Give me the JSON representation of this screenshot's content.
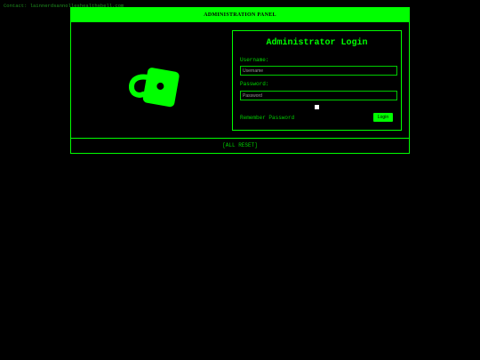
{
  "contact": {
    "text": "Contact: lainnerdsannolleshealthsbell.com"
  },
  "panel": {
    "title": "ADMINISTRATION PANEL",
    "footer": "[ALL RESET]"
  },
  "lock": {
    "icon": "padlock-icon",
    "color": "#00ff00"
  },
  "login": {
    "title": "Administrator Login",
    "username_label": "Username:",
    "username_placeholder": "Username",
    "username_value": "",
    "password_label": "Password:",
    "password_placeholder": "Password",
    "password_value": "",
    "remember_label": "Remember Password",
    "remember_checked": false,
    "button_label": "Login"
  },
  "colors": {
    "background": "#000000",
    "accent": "#00ff00",
    "header_text": "#000000"
  }
}
